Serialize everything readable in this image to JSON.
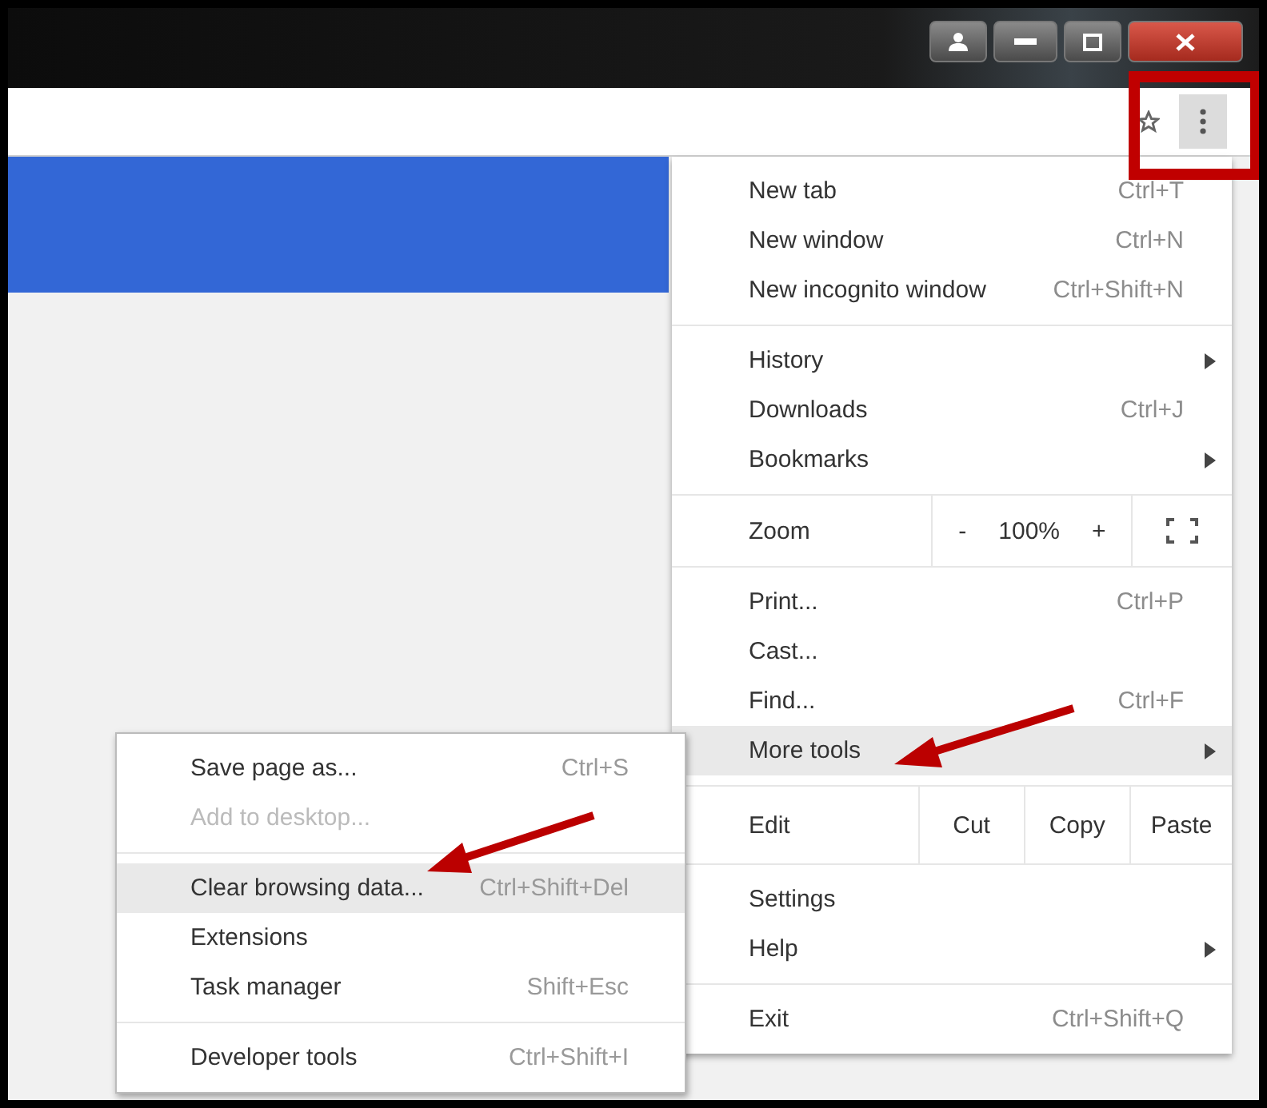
{
  "menu": {
    "sections": [
      {
        "kind": "items",
        "items": [
          {
            "label": "New tab",
            "shortcut": "Ctrl+T",
            "submenu": false,
            "selected": false
          },
          {
            "label": "New window",
            "shortcut": "Ctrl+N",
            "submenu": false,
            "selected": false
          },
          {
            "label": "New incognito window",
            "shortcut": "Ctrl+Shift+N",
            "submenu": false,
            "selected": false
          }
        ]
      },
      {
        "kind": "items",
        "items": [
          {
            "label": "History",
            "submenu": true,
            "selected": false
          },
          {
            "label": "Downloads",
            "shortcut": "Ctrl+J",
            "submenu": false,
            "selected": false
          },
          {
            "label": "Bookmarks",
            "submenu": true,
            "selected": false
          }
        ]
      },
      {
        "kind": "zoom",
        "label": "Zoom",
        "minus": "-",
        "value": "100%",
        "plus": "+"
      },
      {
        "kind": "items",
        "items": [
          {
            "label": "Print...",
            "shortcut": "Ctrl+P",
            "submenu": false,
            "selected": false
          },
          {
            "label": "Cast...",
            "submenu": false,
            "selected": false
          },
          {
            "label": "Find...",
            "shortcut": "Ctrl+F",
            "submenu": false,
            "selected": false
          },
          {
            "label": "More tools",
            "submenu": true,
            "selected": true
          }
        ]
      },
      {
        "kind": "edit",
        "label": "Edit",
        "buttons": [
          "Cut",
          "Copy",
          "Paste"
        ]
      },
      {
        "kind": "items",
        "items": [
          {
            "label": "Settings",
            "submenu": false,
            "selected": false
          },
          {
            "label": "Help",
            "submenu": true,
            "selected": false
          }
        ]
      },
      {
        "kind": "items",
        "items": [
          {
            "label": "Exit",
            "shortcut": "Ctrl+Shift+Q",
            "submenu": false,
            "selected": false
          }
        ]
      }
    ]
  },
  "submenu": {
    "sections": [
      {
        "items": [
          {
            "label": "Save page as...",
            "shortcut": "Ctrl+S",
            "disabled": false,
            "selected": false
          },
          {
            "label": "Add to desktop...",
            "disabled": true,
            "selected": false
          }
        ]
      },
      {
        "items": [
          {
            "label": "Clear browsing data...",
            "shortcut": "Ctrl+Shift+Del",
            "disabled": false,
            "selected": true
          },
          {
            "label": "Extensions",
            "disabled": false,
            "selected": false
          },
          {
            "label": "Task manager",
            "shortcut": "Shift+Esc",
            "disabled": false,
            "selected": false
          }
        ]
      },
      {
        "items": [
          {
            "label": "Developer tools",
            "shortcut": "Ctrl+Shift+I",
            "disabled": false,
            "selected": false
          }
        ]
      }
    ]
  }
}
